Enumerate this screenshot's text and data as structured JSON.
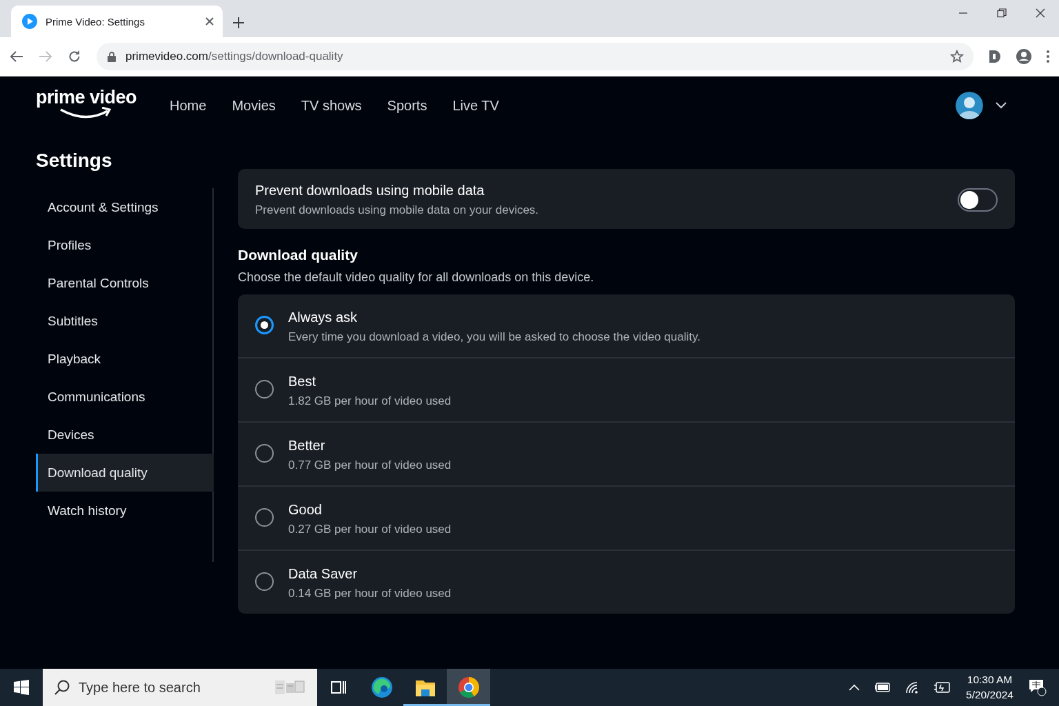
{
  "browser": {
    "tab": {
      "title": "Prime Video: Settings"
    },
    "url": {
      "host": "primevideo.com",
      "path": "/settings/download-quality"
    }
  },
  "header": {
    "logo": "prime video",
    "nav": [
      {
        "label": "Home"
      },
      {
        "label": "Movies"
      },
      {
        "label": "TV shows"
      },
      {
        "label": "Sports"
      },
      {
        "label": "Live TV"
      }
    ]
  },
  "settings": {
    "title": "Settings",
    "sidebar": [
      {
        "label": "Account & Settings",
        "selected": false
      },
      {
        "label": "Profiles",
        "selected": false
      },
      {
        "label": "Parental Controls",
        "selected": false
      },
      {
        "label": "Subtitles",
        "selected": false
      },
      {
        "label": "Playback",
        "selected": false
      },
      {
        "label": "Communications",
        "selected": false
      },
      {
        "label": "Devices",
        "selected": false
      },
      {
        "label": "Download quality",
        "selected": true
      },
      {
        "label": "Watch history",
        "selected": false
      }
    ],
    "mobile_data": {
      "title": "Prevent downloads using mobile data",
      "description": "Prevent downloads using mobile data on your devices.",
      "on": false
    },
    "section": {
      "title": "Download quality",
      "description": "Choose the default video quality for all downloads on this device."
    },
    "options": [
      {
        "title": "Always ask",
        "description": "Every time you download a video, you will be asked to choose the video quality.",
        "selected": true
      },
      {
        "title": "Best",
        "description": "1.82 GB per hour of video used",
        "selected": false
      },
      {
        "title": "Better",
        "description": "0.77 GB per hour of video used",
        "selected": false
      },
      {
        "title": "Good",
        "description": "0.27 GB per hour of video used",
        "selected": false
      },
      {
        "title": "Data Saver",
        "description": "0.14 GB per hour of video used",
        "selected": false
      }
    ]
  },
  "taskbar": {
    "search_placeholder": "Type here to search",
    "apps": [
      {
        "kind": "edge",
        "running": false,
        "selected": false
      },
      {
        "kind": "explorer",
        "running": true,
        "selected": false
      },
      {
        "kind": "chrome",
        "running": true,
        "selected": true
      }
    ],
    "time": "10:30 AM",
    "date": "5/20/2024"
  }
}
